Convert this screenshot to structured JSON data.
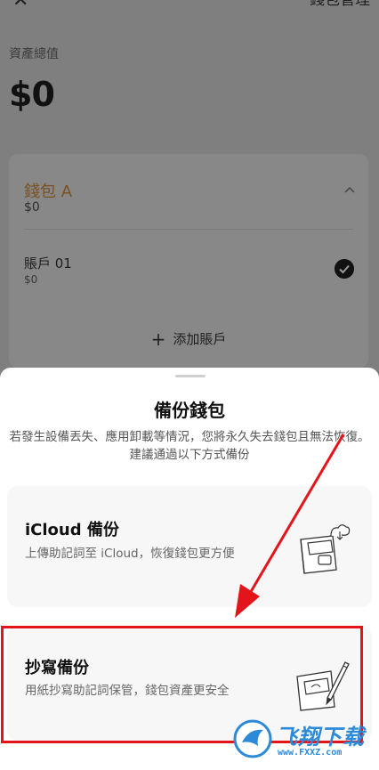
{
  "header": {
    "close_icon": "close-icon",
    "wallet_manage_label": "錢包管理"
  },
  "summary": {
    "total_label": "資產總值",
    "total_value": "$0"
  },
  "wallet": {
    "name": "錢包 A",
    "balance": "$0",
    "accent_color": "#7a5120",
    "accounts": [
      {
        "name": "賬戶 01",
        "balance": "$0",
        "selected": true
      }
    ],
    "add_account_label": "添加賬戶"
  },
  "sheet": {
    "title": "備份錢包",
    "description": "若發生設備丟失、應用卸載等情況，您將永久失去錢包且無法恢復。建議通過以下方式備份",
    "options": [
      {
        "title": "iCloud 備份",
        "description": "上傳助記詞至 iCloud，恢復錢包更方便",
        "icon": "cloud-wallet-icon"
      },
      {
        "title": "抄寫備份",
        "description": "用紙抄寫助記詞保管，錢包資產更安全",
        "icon": "pen-paper-icon"
      }
    ]
  },
  "annotation": {
    "highlight_color": "#e3141a"
  },
  "watermark": {
    "text": "飞翔下载",
    "url": "www.FXXZ.com",
    "color": "#2c8ad8"
  }
}
